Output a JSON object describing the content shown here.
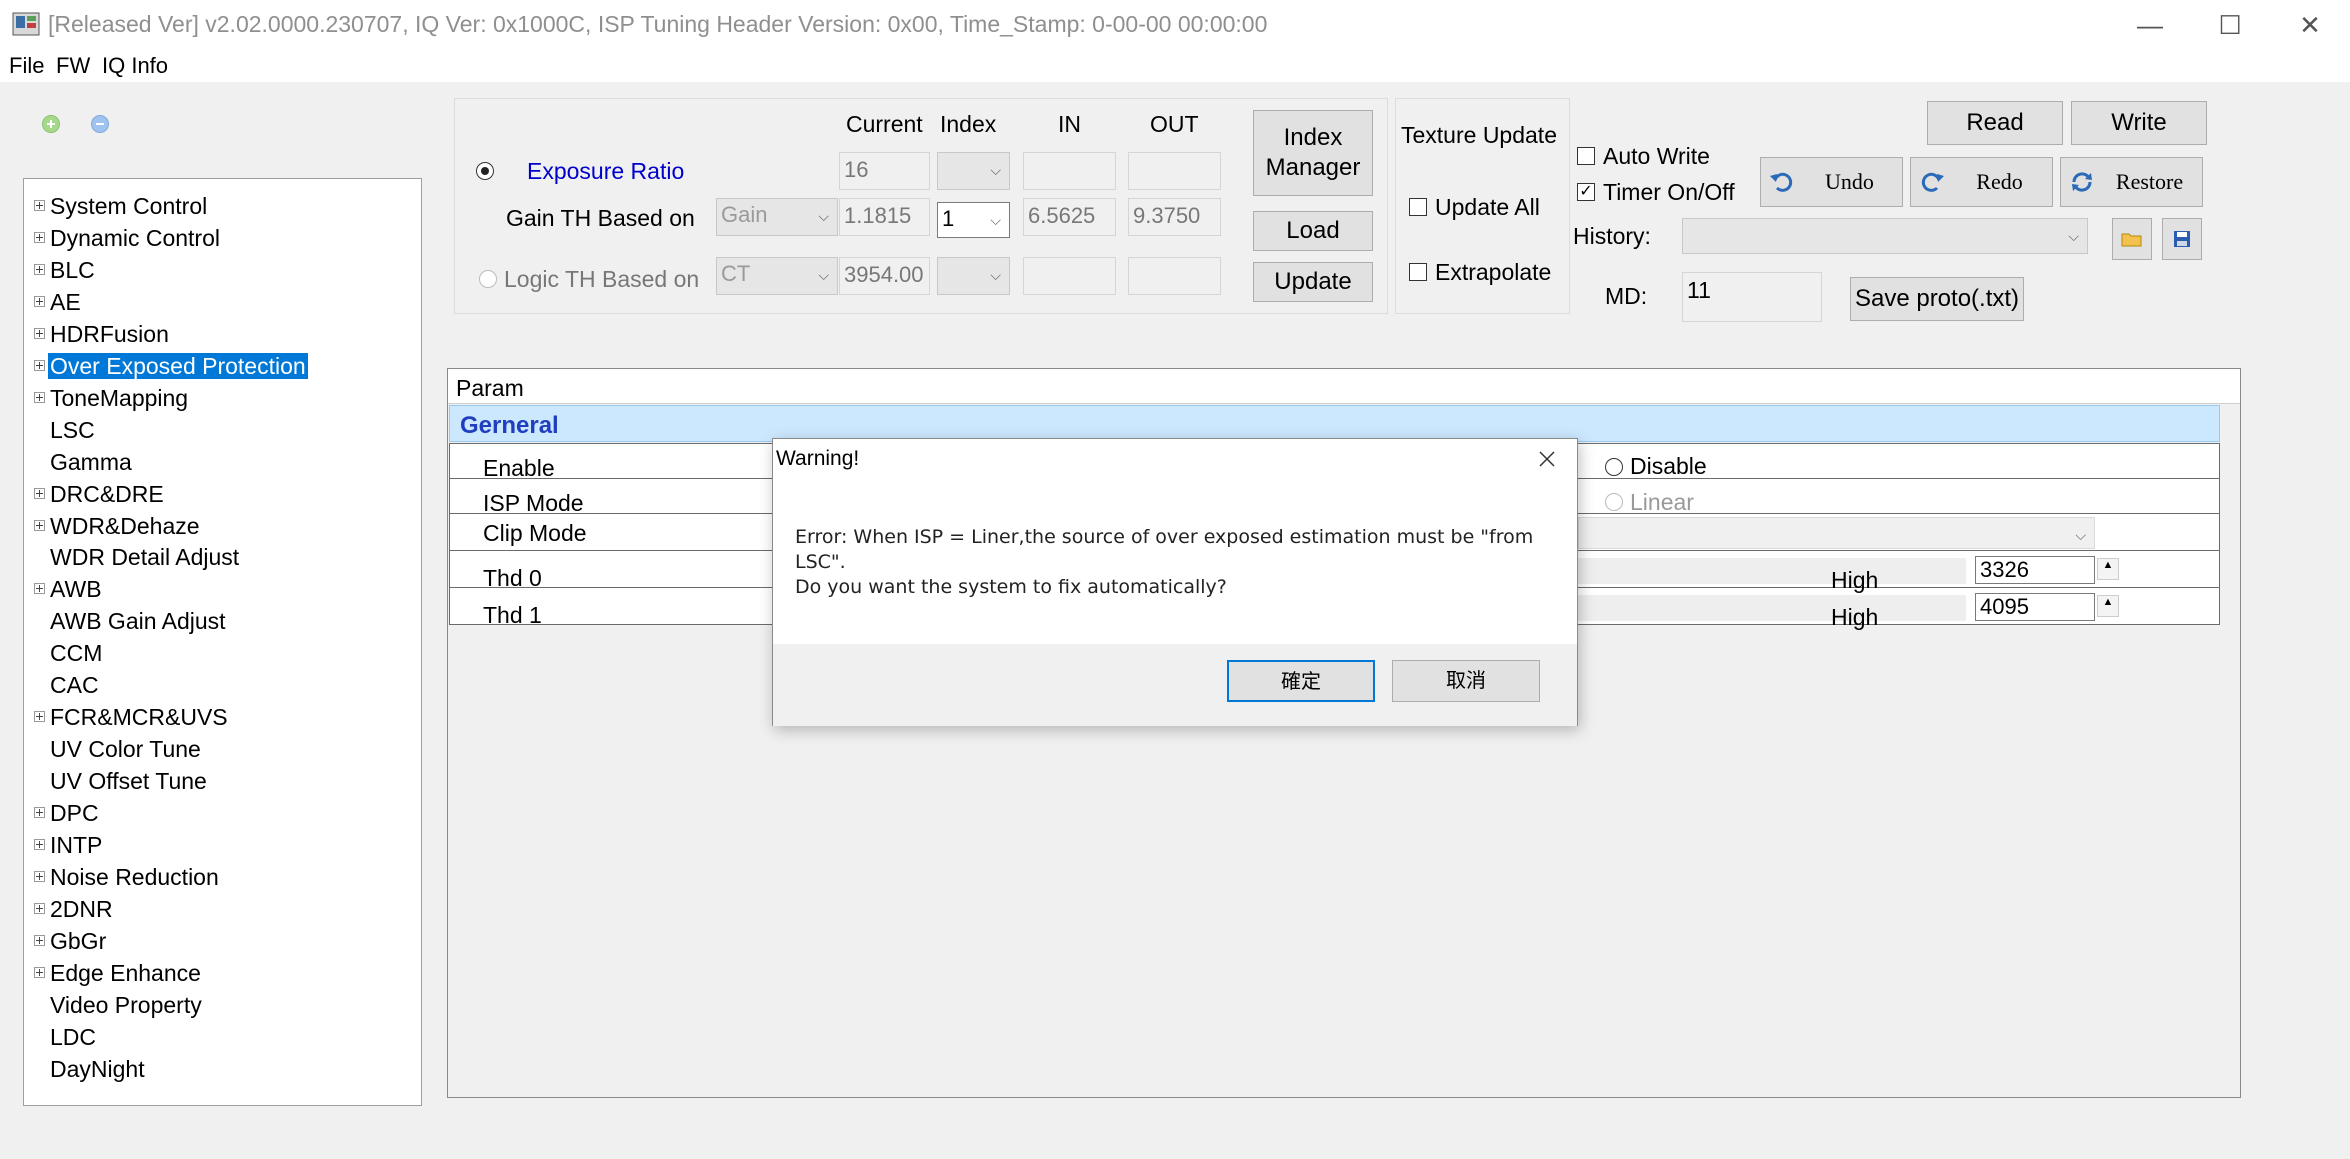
{
  "window": {
    "title": "[Released Ver] v2.02.0000.230707, IQ Ver: 0x1000C, ISP Tuning Header Version: 0x00, Time_Stamp: 0-00-00 00:00:00",
    "minimize_glyph": "—",
    "maximize_glyph": "☐",
    "close_glyph": "✕"
  },
  "menu": [
    "File",
    "FW",
    "IQ Info"
  ],
  "tree": {
    "selected": "Over Exposed Protection",
    "items": [
      {
        "label": "System Control",
        "expandable": true
      },
      {
        "label": "Dynamic Control",
        "expandable": true
      },
      {
        "label": "BLC",
        "expandable": true
      },
      {
        "label": "AE",
        "expandable": true
      },
      {
        "label": "HDRFusion",
        "expandable": true
      },
      {
        "label": "Over Exposed Protection",
        "expandable": true
      },
      {
        "label": "ToneMapping",
        "expandable": true
      },
      {
        "label": "LSC",
        "expandable": false
      },
      {
        "label": "Gamma",
        "expandable": false
      },
      {
        "label": "DRC&DRE",
        "expandable": true
      },
      {
        "label": "WDR&Dehaze",
        "expandable": true
      },
      {
        "label": "WDR Detail Adjust",
        "expandable": false
      },
      {
        "label": "AWB",
        "expandable": true
      },
      {
        "label": "AWB Gain Adjust",
        "expandable": false
      },
      {
        "label": "CCM",
        "expandable": false
      },
      {
        "label": "CAC",
        "expandable": false
      },
      {
        "label": "FCR&MCR&UVS",
        "expandable": true
      },
      {
        "label": "UV Color Tune",
        "expandable": false
      },
      {
        "label": "UV Offset Tune",
        "expandable": false
      },
      {
        "label": "DPC",
        "expandable": true
      },
      {
        "label": "INTP",
        "expandable": true
      },
      {
        "label": "Noise Reduction",
        "expandable": true
      },
      {
        "label": "2DNR",
        "expandable": true
      },
      {
        "label": "GbGr",
        "expandable": true
      },
      {
        "label": "Edge Enhance",
        "expandable": true
      },
      {
        "label": "Video Property",
        "expandable": false
      },
      {
        "label": "LDC",
        "expandable": false
      },
      {
        "label": "DayNight",
        "expandable": false
      }
    ]
  },
  "index_panel": {
    "headers": {
      "current": "Current",
      "index": "Index",
      "in": "IN",
      "out": "OUT"
    },
    "exposure_ratio": {
      "label": "Exposure Ratio",
      "current": "16",
      "index": "",
      "in": "",
      "out": ""
    },
    "gain_th": {
      "label": "Gain TH Based on",
      "source": "Gain",
      "current": "1.1815",
      "index": "1",
      "in": "6.5625",
      "out": "9.3750"
    },
    "logic_th": {
      "label": "Logic TH Based on",
      "source": "CT",
      "current": "3954.00",
      "index": "",
      "in": "",
      "out": ""
    }
  },
  "buttons": {
    "index_manager_line1": "Index",
    "index_manager_line2": "Manager",
    "load": "Load",
    "update": "Update",
    "read": "Read",
    "write": "Write",
    "undo": "Undo",
    "redo": "Redo",
    "restore": "Restore",
    "save_proto": "Save proto(.txt)"
  },
  "texture": {
    "title": "Texture Update",
    "update_all": "Update All",
    "extrapolate": "Extrapolate"
  },
  "options": {
    "auto_write": "Auto Write",
    "timer": "Timer On/Off",
    "timer_checked": "✓",
    "history_label": "History:",
    "md_label": "MD:",
    "md_value": "11"
  },
  "param": {
    "header": "Param",
    "section": "Gerneral",
    "rows": {
      "enable": "Enable",
      "isp_mode": "ISP Mode",
      "clip_mode": "Clip Mode",
      "thd0": "Thd 0",
      "thd1": "Thd 1"
    },
    "enable_option": "Disable",
    "isp_option": "Linear",
    "thd0_high_label": "High",
    "thd0_high_value": "3326",
    "thd1_high_label": "High",
    "thd1_high_value": "4095"
  },
  "dialog": {
    "title": "Warning!",
    "line1": "Error: When ISP = Liner,the source of over exposed estimation must be \"from",
    "line2": "LSC\".",
    "line3": "Do you want the system to fix automatically?",
    "ok": "確定",
    "cancel": "取消"
  },
  "colors": {
    "accent": "#0078d7",
    "link_blue": "#0000cc",
    "section_bg": "#cce8ff"
  }
}
